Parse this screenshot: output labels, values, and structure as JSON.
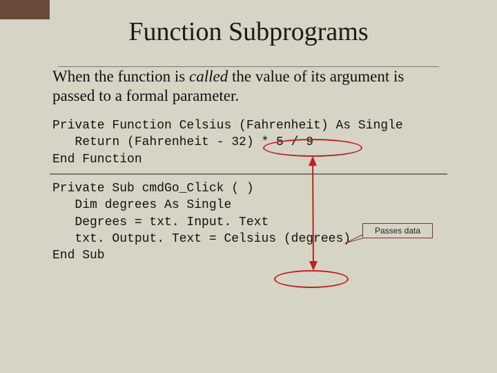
{
  "title": "Function Subprograms",
  "body": {
    "pre": "When the function is ",
    "italic": "called",
    "post": " the value of its argument is passed to a formal parameter."
  },
  "code1": {
    "l1": "Private Function Celsius (Fahrenheit) As Single",
    "l2": "   Return (Fahrenheit - 32) * 5 / 9",
    "l3": "End Function"
  },
  "code2": {
    "l1": "Private Sub cmdGo_Click ( )",
    "l2": "   Dim degrees As Single",
    "l3": "   Degrees = txt. Input. Text",
    "l4": "   txt. Output. Text = Celsius (degrees)",
    "l5": "End Sub"
  },
  "callout": "Passes data"
}
